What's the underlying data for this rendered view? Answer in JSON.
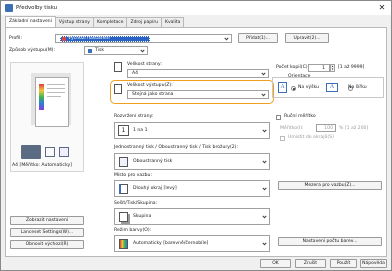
{
  "window": {
    "title": "Předvolby tisku",
    "close_glyph": "✕"
  },
  "tabs": [
    {
      "label": "Základní nastavení"
    },
    {
      "label": "Výstup strany"
    },
    {
      "label": "Kompletace"
    },
    {
      "label": "Zdroj papíru"
    },
    {
      "label": "Kvalita"
    }
  ],
  "profile": {
    "label": "Profil:",
    "value": "Výchozí nastavení",
    "add": "Přidat(1)...",
    "edit": "Upravit(2)..."
  },
  "output_method": {
    "label": "Způsob výstupu(M):",
    "value": "Tisk"
  },
  "page_size": {
    "label": "Velikost strany:",
    "value": "A4"
  },
  "output_size": {
    "label": "Velikost výstupu(Z):",
    "value": "Stejná jako strana"
  },
  "copies": {
    "label": "Počet kopií(C):",
    "value": "1",
    "range": "[1 až 9999]"
  },
  "orientation": {
    "label": "Orientace",
    "portrait": "Na výšku",
    "landscape": "Na šířku",
    "glyph": "A"
  },
  "preview": {
    "caption": "A4 [Měřítko: Automaticky]"
  },
  "layout": {
    "label": "Rozvržení strany:",
    "value": "1 na 1",
    "icon_glyph": "1"
  },
  "manual_scale": {
    "label": "Ruční měřítko",
    "scale_label": "Měřítko(I):",
    "scale_value": "100",
    "scale_unit": "% [1 až 200]",
    "watermark_label": "Umístit do okrajů(S)"
  },
  "duplex": {
    "label": "Jednostranný tisk / Oboustranný tisk / Tisk brožury(2):",
    "value": "Oboustranný tisk"
  },
  "binding": {
    "label": "Místo pro vazbu:",
    "value": "Dlouhý okraj [levý]",
    "button": "Mezera pro vazbu(Z)..."
  },
  "staple": {
    "label": "Sešít/Tisk/Skupina:",
    "value": "Skupina"
  },
  "color_mode": {
    "label": "Režim barvy(O):",
    "value": "Automaticky [barevně/černobíle]",
    "button": "Nastavení počtu barev..."
  },
  "left_buttons": [
    {
      "label": "Zobrazit nastavení"
    },
    {
      "label": "Lanceset Settings(W)..."
    },
    {
      "label": "Obnovit výchozí(R)"
    }
  ],
  "bottom": {
    "ok": "OK",
    "cancel": "Zrušit",
    "apply": "Použít",
    "help": "Nápověda"
  }
}
